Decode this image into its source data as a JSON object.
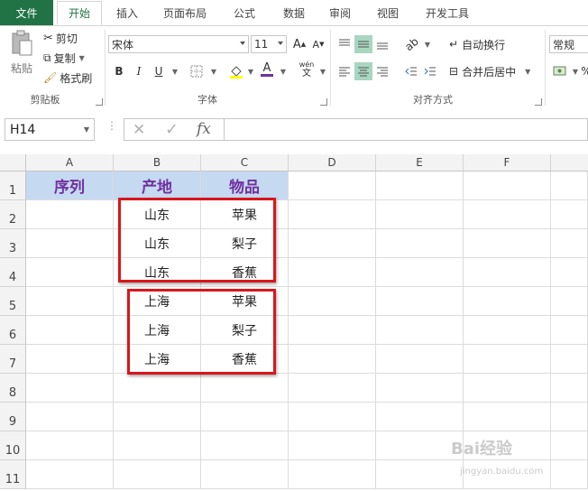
{
  "tabs": {
    "file": "文件",
    "items": [
      "开始",
      "插入",
      "页面布局",
      "公式",
      "数据",
      "审阅",
      "视图",
      "开发工具"
    ],
    "active": 0
  },
  "ribbon": {
    "clipboard": {
      "paste": "粘贴",
      "cut": "剪切",
      "copy": "复制",
      "format_painter": "格式刷",
      "label": "剪贴板"
    },
    "font": {
      "font_name": "宋体",
      "font_size": "11",
      "bold": "B",
      "italic": "I",
      "underline": "U",
      "phonetic": "wén",
      "label": "字体"
    },
    "alignment": {
      "wrap_text": "自动换行",
      "merge_center": "合并后居中",
      "label": "对齐方式"
    },
    "number": {
      "format": "常规"
    }
  },
  "formula_bar": {
    "name_box": "H14",
    "cancel_icon": "✕",
    "enter_icon": "✓",
    "fx": "fx",
    "formula": ""
  },
  "sheet": {
    "columns": [
      "A",
      "B",
      "C",
      "D",
      "E",
      "F"
    ],
    "rows": [
      "1",
      "2",
      "3",
      "4",
      "5",
      "6",
      "7",
      "8",
      "9",
      "10",
      "11"
    ],
    "header_row": [
      "序列",
      "产地",
      "物品"
    ],
    "data": [
      [
        "",
        "山东",
        "苹果"
      ],
      [
        "",
        "山东",
        "梨子"
      ],
      [
        "",
        "山东",
        "香蕉"
      ],
      [
        "",
        "上海",
        "苹果"
      ],
      [
        "",
        "上海",
        "梨子"
      ],
      [
        "",
        "上海",
        "香蕉"
      ]
    ]
  },
  "watermark": {
    "text": "Bai经验",
    "url": "jingyan.baidu.com"
  },
  "colors": {
    "brand": "#217346",
    "header_fill": "#c5d9f1",
    "header_text": "#7030a0",
    "highlight_box": "#d9161c"
  }
}
